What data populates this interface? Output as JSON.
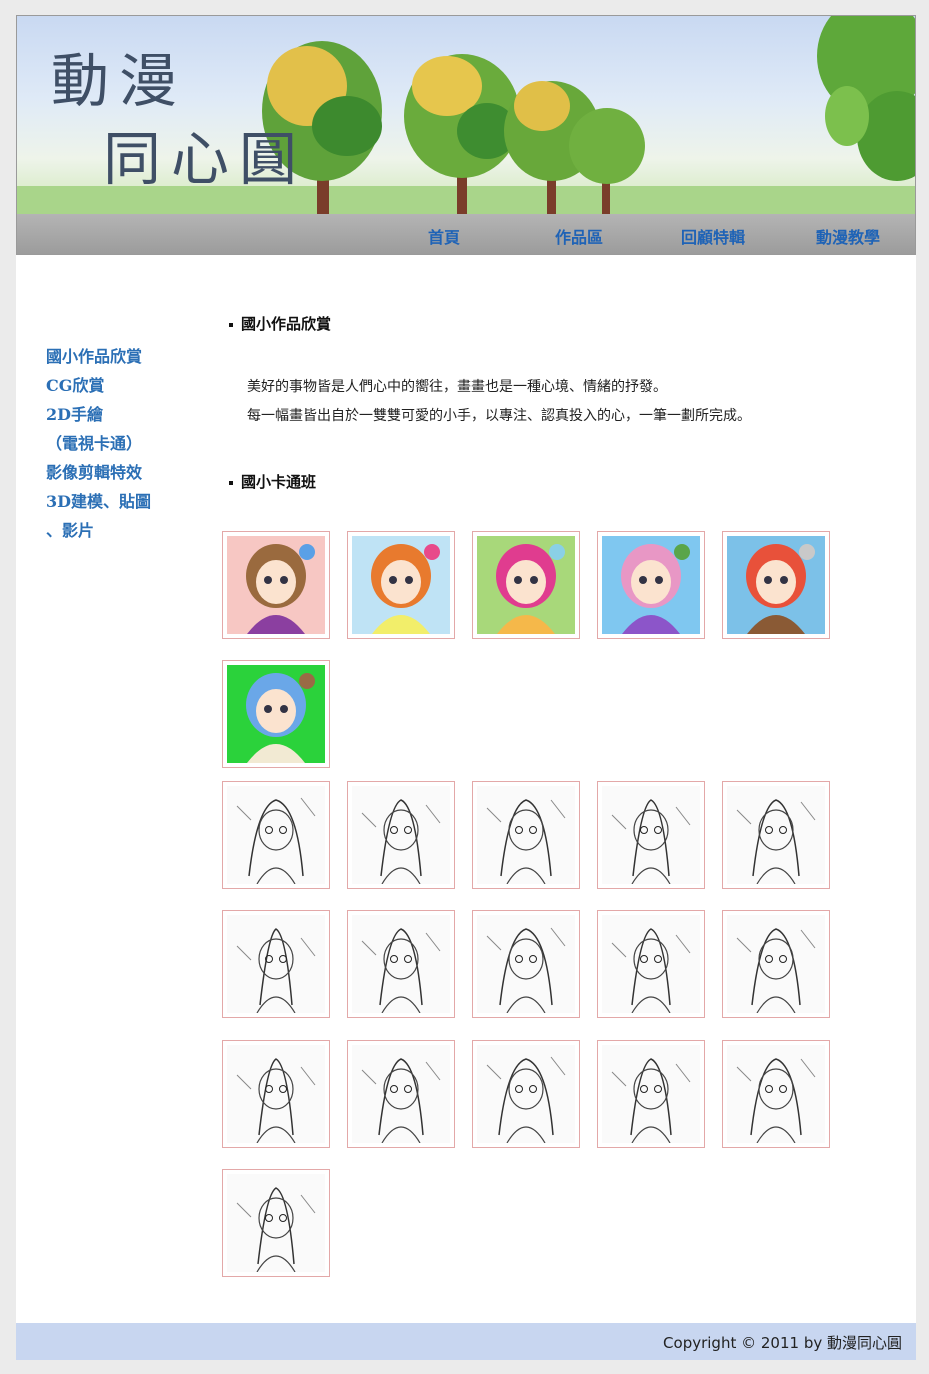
{
  "site": {
    "title_line1": "動漫",
    "title_line2": "同心圓"
  },
  "nav": [
    "首頁",
    "作品區",
    "回顧特輯",
    "動漫教學"
  ],
  "sidebar": [
    "國小作品欣賞",
    "CG欣賞",
    "2D手繪",
    "（電視卡通）",
    "影像剪輯特效",
    "3D建模、貼圖",
    "、影片"
  ],
  "sections": {
    "gallery_title": "國小作品欣賞",
    "intro": [
      "美好的事物皆是人們心中的嚮往，畫畫也是一種心境、情緒的抒發。",
      "每一幅畫皆出自於一雙雙可愛的小手，以專注、認真投入的心，一筆一劃所完成。"
    ],
    "class_title": "國小卡通班"
  },
  "thumbnails": {
    "color": [
      {
        "name": "thumbnail-brown-hair-girl",
        "colors": [
          "#f7c7c3",
          "#9a6a3e",
          "#8b3fa0",
          "#5aa0e6"
        ]
      },
      {
        "name": "thumbnail-hat-girl",
        "colors": [
          "#bfe3f5",
          "#e87a2e",
          "#f2ee6a",
          "#e84a8a"
        ]
      },
      {
        "name": "thumbnail-pink-hat-girl",
        "colors": [
          "#a8d87a",
          "#e03c8f",
          "#f5b84a",
          "#8ad0e6"
        ]
      },
      {
        "name": "thumbnail-purple-dress-girl",
        "colors": [
          "#7fc7f0",
          "#e897c5",
          "#8c55c9",
          "#5aa54a"
        ]
      },
      {
        "name": "thumbnail-boy-and-monkey",
        "colors": [
          "#7cc1e8",
          "#e8513a",
          "#8a5a35",
          "#c9c9c9"
        ]
      },
      {
        "name": "thumbnail-blue-door",
        "colors": [
          "#2bd23b",
          "#6aa7e8",
          "#f2ead3",
          "#9a6a45"
        ]
      }
    ],
    "sketch_count": 16
  },
  "footer": {
    "copyright": "Copyright © 2011 by 動漫同心圓"
  }
}
